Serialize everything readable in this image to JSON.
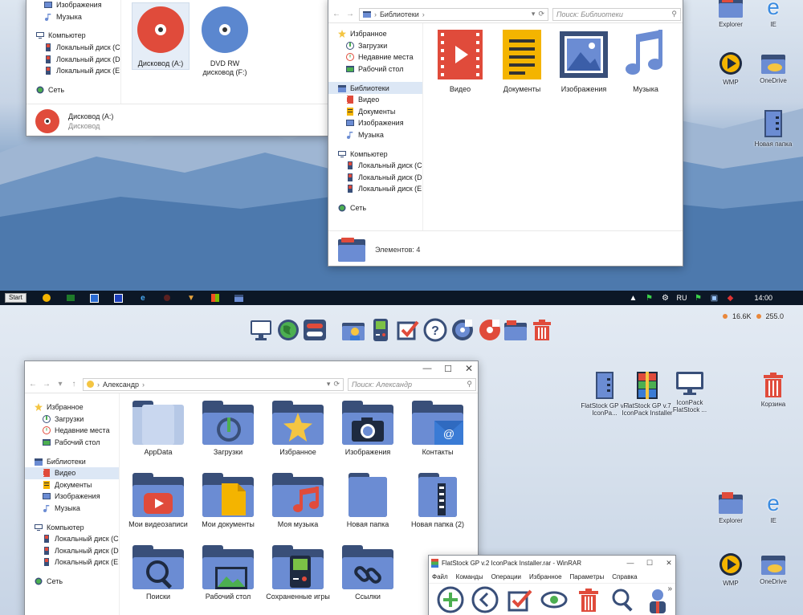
{
  "win1": {
    "sidebar": [
      {
        "label": "Изображения",
        "indent": 1
      },
      {
        "label": "Музыка",
        "indent": 1
      },
      {
        "label": "",
        "indent": 0
      },
      {
        "label": "Компьютер",
        "indent": 0
      },
      {
        "label": "Локальный диск (C:)",
        "indent": 1
      },
      {
        "label": "Локальный диск (D:)",
        "indent": 1
      },
      {
        "label": "Локальный диск (E:)",
        "indent": 1
      },
      {
        "label": "",
        "indent": 0
      },
      {
        "label": "Сеть",
        "indent": 0
      }
    ],
    "drives": [
      {
        "label": "Дисковод (A:)",
        "color": "#e04b3b"
      },
      {
        "label": "DVD RW дисковод (F:)",
        "color": "#5b87cf"
      }
    ],
    "status_name": "Дисковод (A:)",
    "status_type": "Дисковод"
  },
  "win2": {
    "address": "Библиотеки",
    "search_placeholder": "Поиск: Библиотеки",
    "sidebar": [
      {
        "label": "Избранное",
        "indent": 0,
        "icon": "star"
      },
      {
        "label": "Загрузки",
        "indent": 1,
        "icon": "download"
      },
      {
        "label": "Недавние места",
        "indent": 1,
        "icon": "recent"
      },
      {
        "label": "Рабочий стол",
        "indent": 1,
        "icon": "desktop"
      },
      {
        "label": "",
        "indent": 0,
        "icon": ""
      },
      {
        "label": "Библиотеки",
        "indent": 0,
        "icon": "library",
        "selected": true
      },
      {
        "label": "Видео",
        "indent": 1,
        "icon": "video"
      },
      {
        "label": "Документы",
        "indent": 1,
        "icon": "docs"
      },
      {
        "label": "Изображения",
        "indent": 1,
        "icon": "image"
      },
      {
        "label": "Музыка",
        "indent": 1,
        "icon": "music"
      },
      {
        "label": "",
        "indent": 0,
        "icon": ""
      },
      {
        "label": "Компьютер",
        "indent": 0,
        "icon": "computer"
      },
      {
        "label": "Локальный диск (C:)",
        "indent": 1,
        "icon": "disk"
      },
      {
        "label": "Локальный диск (D:)",
        "indent": 1,
        "icon": "disk"
      },
      {
        "label": "Локальный диск (E:)",
        "indent": 1,
        "icon": "disk"
      },
      {
        "label": "",
        "indent": 0,
        "icon": ""
      },
      {
        "label": "Сеть",
        "indent": 0,
        "icon": "network"
      }
    ],
    "libraries": [
      {
        "label": "Видео",
        "icon": "video-library-icon"
      },
      {
        "label": "Документы",
        "icon": "documents-library-icon"
      },
      {
        "label": "Изображения",
        "icon": "images-library-icon"
      },
      {
        "label": "Музыка",
        "icon": "music-library-icon"
      }
    ],
    "status": "Элементов: 4"
  },
  "taskbar": {
    "start": "Start",
    "lang": "RU",
    "clock": "14:00"
  },
  "sys_meter": {
    "left": "16.6K",
    "right": "255.0"
  },
  "desktop_top": [
    {
      "label": "Explorer"
    },
    {
      "label": "IE"
    },
    {
      "label": "WMP"
    },
    {
      "label": "OneDrive"
    },
    {
      "label": "Новая папка"
    }
  ],
  "desktop_bottom": [
    {
      "label": "FlatStock GP v.7 IconPa..."
    },
    {
      "label": "FlatStock GP v.7 IconPack Installer"
    },
    {
      "label": "IconPack FlatStock ..."
    },
    {
      "label": "Корзина"
    },
    {
      "label": "Explorer"
    },
    {
      "label": "IE"
    },
    {
      "label": "WMP"
    },
    {
      "label": "OneDrive"
    }
  ],
  "win3": {
    "address": "Александр",
    "search_placeholder": "Поиск: Александр",
    "sidebar": [
      {
        "label": "Избранное",
        "indent": 0,
        "icon": "star"
      },
      {
        "label": "Загрузки",
        "indent": 1,
        "icon": "download"
      },
      {
        "label": "Недавние места",
        "indent": 1,
        "icon": "recent"
      },
      {
        "label": "Рабочий стол",
        "indent": 1,
        "icon": "desktop"
      },
      {
        "label": "",
        "indent": 0,
        "icon": ""
      },
      {
        "label": "Библиотеки",
        "indent": 0,
        "icon": "library"
      },
      {
        "label": "Видео",
        "indent": 1,
        "icon": "video",
        "selected": true
      },
      {
        "label": "Документы",
        "indent": 1,
        "icon": "docs"
      },
      {
        "label": "Изображения",
        "indent": 1,
        "icon": "image"
      },
      {
        "label": "Музыка",
        "indent": 1,
        "icon": "music"
      },
      {
        "label": "",
        "indent": 0,
        "icon": ""
      },
      {
        "label": "Компьютер",
        "indent": 0,
        "icon": "computer"
      },
      {
        "label": "Локальный диск (C:)",
        "indent": 1,
        "icon": "disk"
      },
      {
        "label": "Локальный диск (D:)",
        "indent": 1,
        "icon": "disk"
      },
      {
        "label": "Локальный диск (E:)",
        "indent": 1,
        "icon": "disk"
      },
      {
        "label": "",
        "indent": 0,
        "icon": ""
      },
      {
        "label": "Сеть",
        "indent": 0,
        "icon": "network"
      }
    ],
    "folders": [
      {
        "label": "AppData",
        "emblem": "appdata"
      },
      {
        "label": "Загрузки",
        "emblem": "download"
      },
      {
        "label": "Избранное",
        "emblem": "star"
      },
      {
        "label": "Изображения",
        "emblem": "camera"
      },
      {
        "label": "Контакты",
        "emblem": "contacts"
      },
      {
        "label": "Мои видеозаписи",
        "emblem": "youtube"
      },
      {
        "label": "Мои документы",
        "emblem": "doc"
      },
      {
        "label": "Моя музыка",
        "emblem": "music"
      },
      {
        "label": "Новая папка",
        "emblem": "plain"
      },
      {
        "label": "Новая папка (2)",
        "emblem": "zip"
      },
      {
        "label": "Поиски",
        "emblem": "search"
      },
      {
        "label": "Рабочий стол",
        "emblem": "landscape"
      },
      {
        "label": "Сохраненные игры",
        "emblem": "gameboy"
      },
      {
        "label": "Ссылки",
        "emblem": "link"
      }
    ]
  },
  "winrar": {
    "title": "FlatStock GP v.2  IconPack Installer.rar - WinRAR",
    "menu": [
      "Файл",
      "Команды",
      "Операции",
      "Избранное",
      "Параметры",
      "Справка"
    ],
    "more": "»"
  }
}
